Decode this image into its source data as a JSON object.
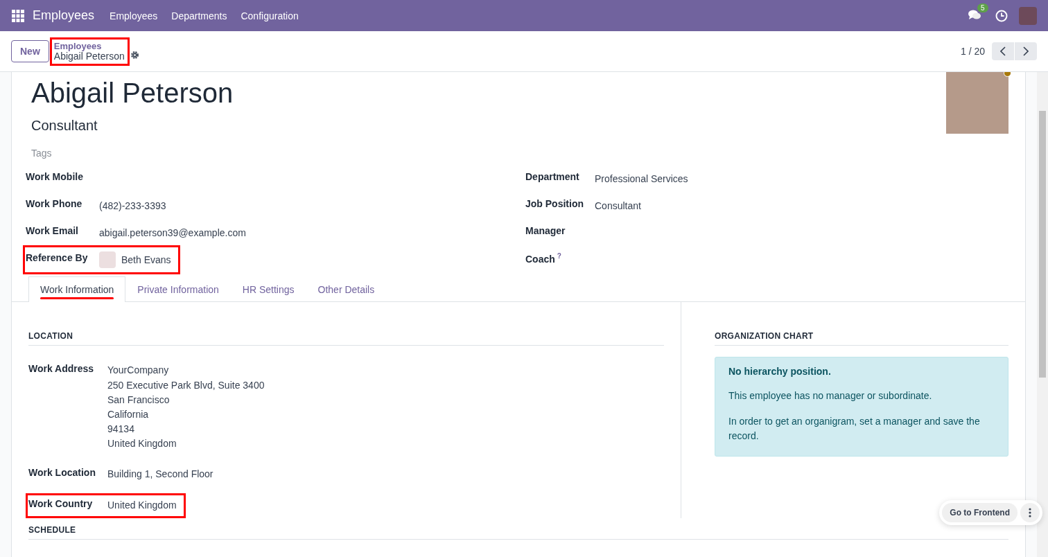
{
  "navbar": {
    "app_name": "Employees",
    "menu": [
      "Employees",
      "Departments",
      "Configuration"
    ],
    "message_count": "5"
  },
  "control_panel": {
    "new_button": "New",
    "breadcrumb": {
      "parent": "Employees",
      "current": "Abigail Peterson",
      "highlighted": true
    },
    "pager": "1 / 20"
  },
  "employee": {
    "name": "Abigail Peterson",
    "job_title": "Consultant",
    "tags_placeholder": "Tags"
  },
  "left_fields": [
    {
      "label": "Work Mobile",
      "kind": "text",
      "highlighted": false
    },
    {
      "label": "Work Phone",
      "kind": "text",
      "value": "(482)-233-3393",
      "highlighted": false
    },
    {
      "label": "Work Email",
      "kind": "text",
      "value": "abigail.peterson39@example.com",
      "highlighted": false
    },
    {
      "label": "Reference By",
      "kind": "avatar",
      "value": "Beth Evans",
      "highlighted": true
    }
  ],
  "right_fields": [
    {
      "label": "Department",
      "value": "Professional Services"
    },
    {
      "label": "Job Position",
      "value": "Consultant"
    },
    {
      "label": "Manager"
    },
    {
      "label": "Coach",
      "help": "?"
    }
  ],
  "tabs": [
    {
      "label": "Work Information",
      "selected": true,
      "underlined": true
    },
    {
      "label": "Private Information",
      "selected": false,
      "underlined": false
    },
    {
      "label": "HR Settings",
      "selected": false,
      "underlined": false
    },
    {
      "label": "Other Details",
      "selected": false,
      "underlined": false
    }
  ],
  "location": {
    "title": "LOCATION",
    "fields": [
      {
        "label": "Work Address",
        "lines": [
          "YourCompany",
          "250 Executive Park Blvd, Suite 3400",
          "San Francisco",
          "California",
          "94134",
          "United Kingdom"
        ],
        "highlighted": false
      },
      {
        "label": "Work Location",
        "lines": [
          "Building 1, Second Floor"
        ],
        "highlighted": false
      },
      {
        "label": "Work Country",
        "lines": [
          "United Kingdom"
        ],
        "highlighted": true
      }
    ]
  },
  "organization_chart": {
    "title": "ORGANIZATION CHART",
    "heading": "No hierarchy position.",
    "paragraphs": [
      "This employee has no manager or subordinate.",
      "In order to get an organigram, set a manager and save the record."
    ]
  },
  "schedule": {
    "title": "SCHEDULE"
  },
  "floating_action": {
    "label": "Go to Frontend"
  }
}
